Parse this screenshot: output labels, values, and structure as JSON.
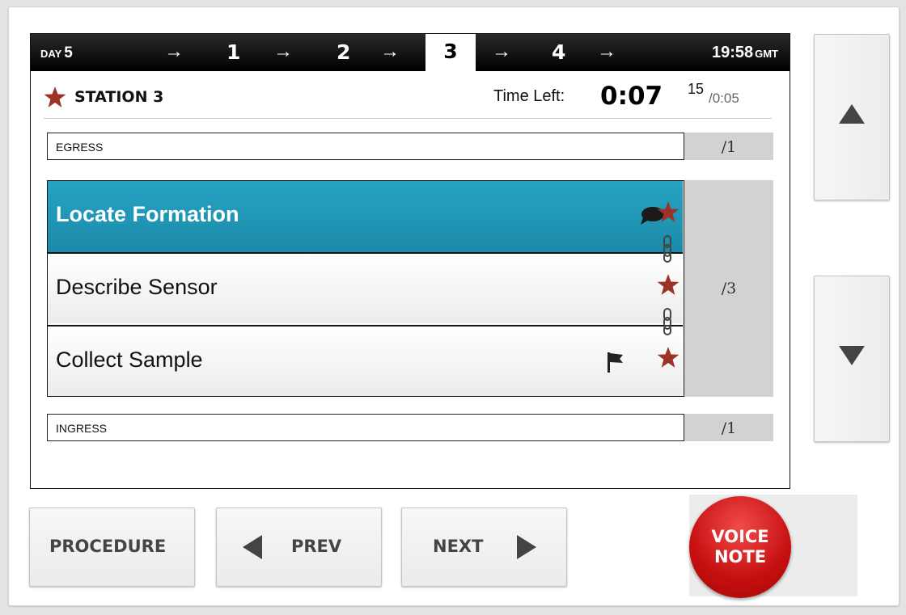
{
  "header": {
    "day_label": "DAY",
    "day_number": "5",
    "steps": [
      "1",
      "2",
      "3",
      "4"
    ],
    "active_step": "3",
    "arrow": "→",
    "clock_time": "19:58",
    "clock_zone": "GMT"
  },
  "station": {
    "title": "STATION 3",
    "time_left_label": "Time Left:",
    "time_left_main": "0:07",
    "time_left_seconds": "15",
    "time_total": "/0:05"
  },
  "egress": {
    "label": "EGRESS",
    "count": "/1"
  },
  "tasks": [
    {
      "label": "Locate Formation",
      "selected": true
    },
    {
      "label": "Describe Sensor",
      "selected": false
    },
    {
      "label": "Collect Sample",
      "selected": false
    }
  ],
  "task_count": "/3",
  "ingress": {
    "label": "INGRESS",
    "count": "/1"
  },
  "buttons": {
    "procedure": "PROCEDURE",
    "prev": "PREV",
    "next": "NEXT",
    "voice_line1": "VOICE",
    "voice_line2": "NOTE"
  },
  "colors": {
    "selected_task": "#1f95b6",
    "star": "#9b3426",
    "voice_button": "#d21414",
    "header_bg": "#000000"
  },
  "icons": {
    "star": "star-icon",
    "speech": "speech-bubble-icon",
    "flag": "flag-icon",
    "link": "chain-link-icon",
    "up": "triangle-up-icon",
    "down": "triangle-down-icon",
    "prev": "triangle-left-icon",
    "next": "triangle-right-icon"
  }
}
